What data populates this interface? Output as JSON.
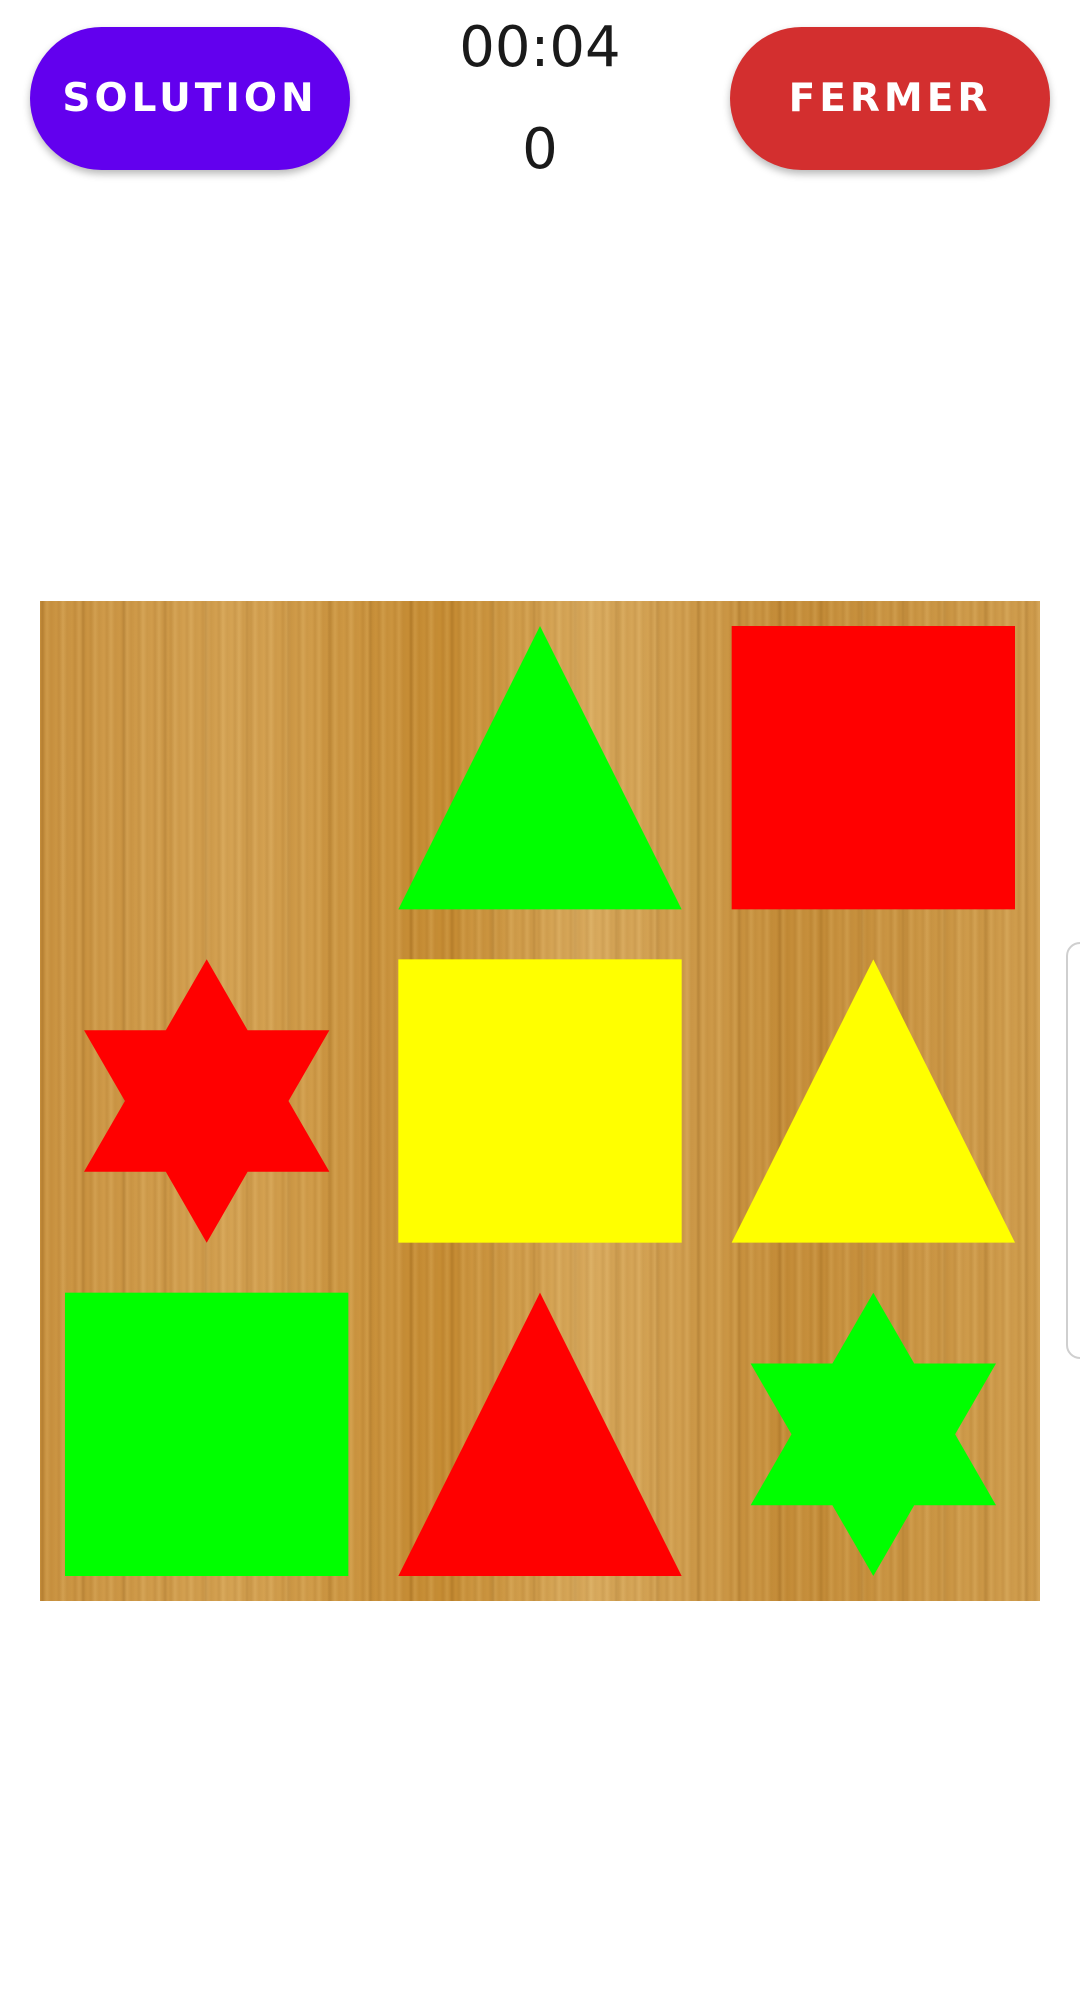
{
  "header": {
    "solution_label": "SOLUTION",
    "close_label": "FERMER",
    "timer": "00:04",
    "moves": "0"
  },
  "colors": {
    "solution_button": "#6200ee",
    "close_button": "#d32f2f",
    "green": "#00ff00",
    "red": "#ff0000",
    "yellow": "#ffff00",
    "board_wood": "#c9923f"
  },
  "board": {
    "rows": 3,
    "cols": 3,
    "pieces": [
      {
        "row": 0,
        "col": 0,
        "shape": "empty",
        "color": null
      },
      {
        "row": 0,
        "col": 1,
        "shape": "triangle",
        "color": "green"
      },
      {
        "row": 0,
        "col": 2,
        "shape": "square",
        "color": "red"
      },
      {
        "row": 1,
        "col": 0,
        "shape": "star",
        "color": "red"
      },
      {
        "row": 1,
        "col": 1,
        "shape": "square",
        "color": "yellow"
      },
      {
        "row": 1,
        "col": 2,
        "shape": "triangle",
        "color": "yellow"
      },
      {
        "row": 2,
        "col": 0,
        "shape": "square",
        "color": "green"
      },
      {
        "row": 2,
        "col": 1,
        "shape": "triangle",
        "color": "red"
      },
      {
        "row": 2,
        "col": 2,
        "shape": "star",
        "color": "green"
      }
    ]
  }
}
